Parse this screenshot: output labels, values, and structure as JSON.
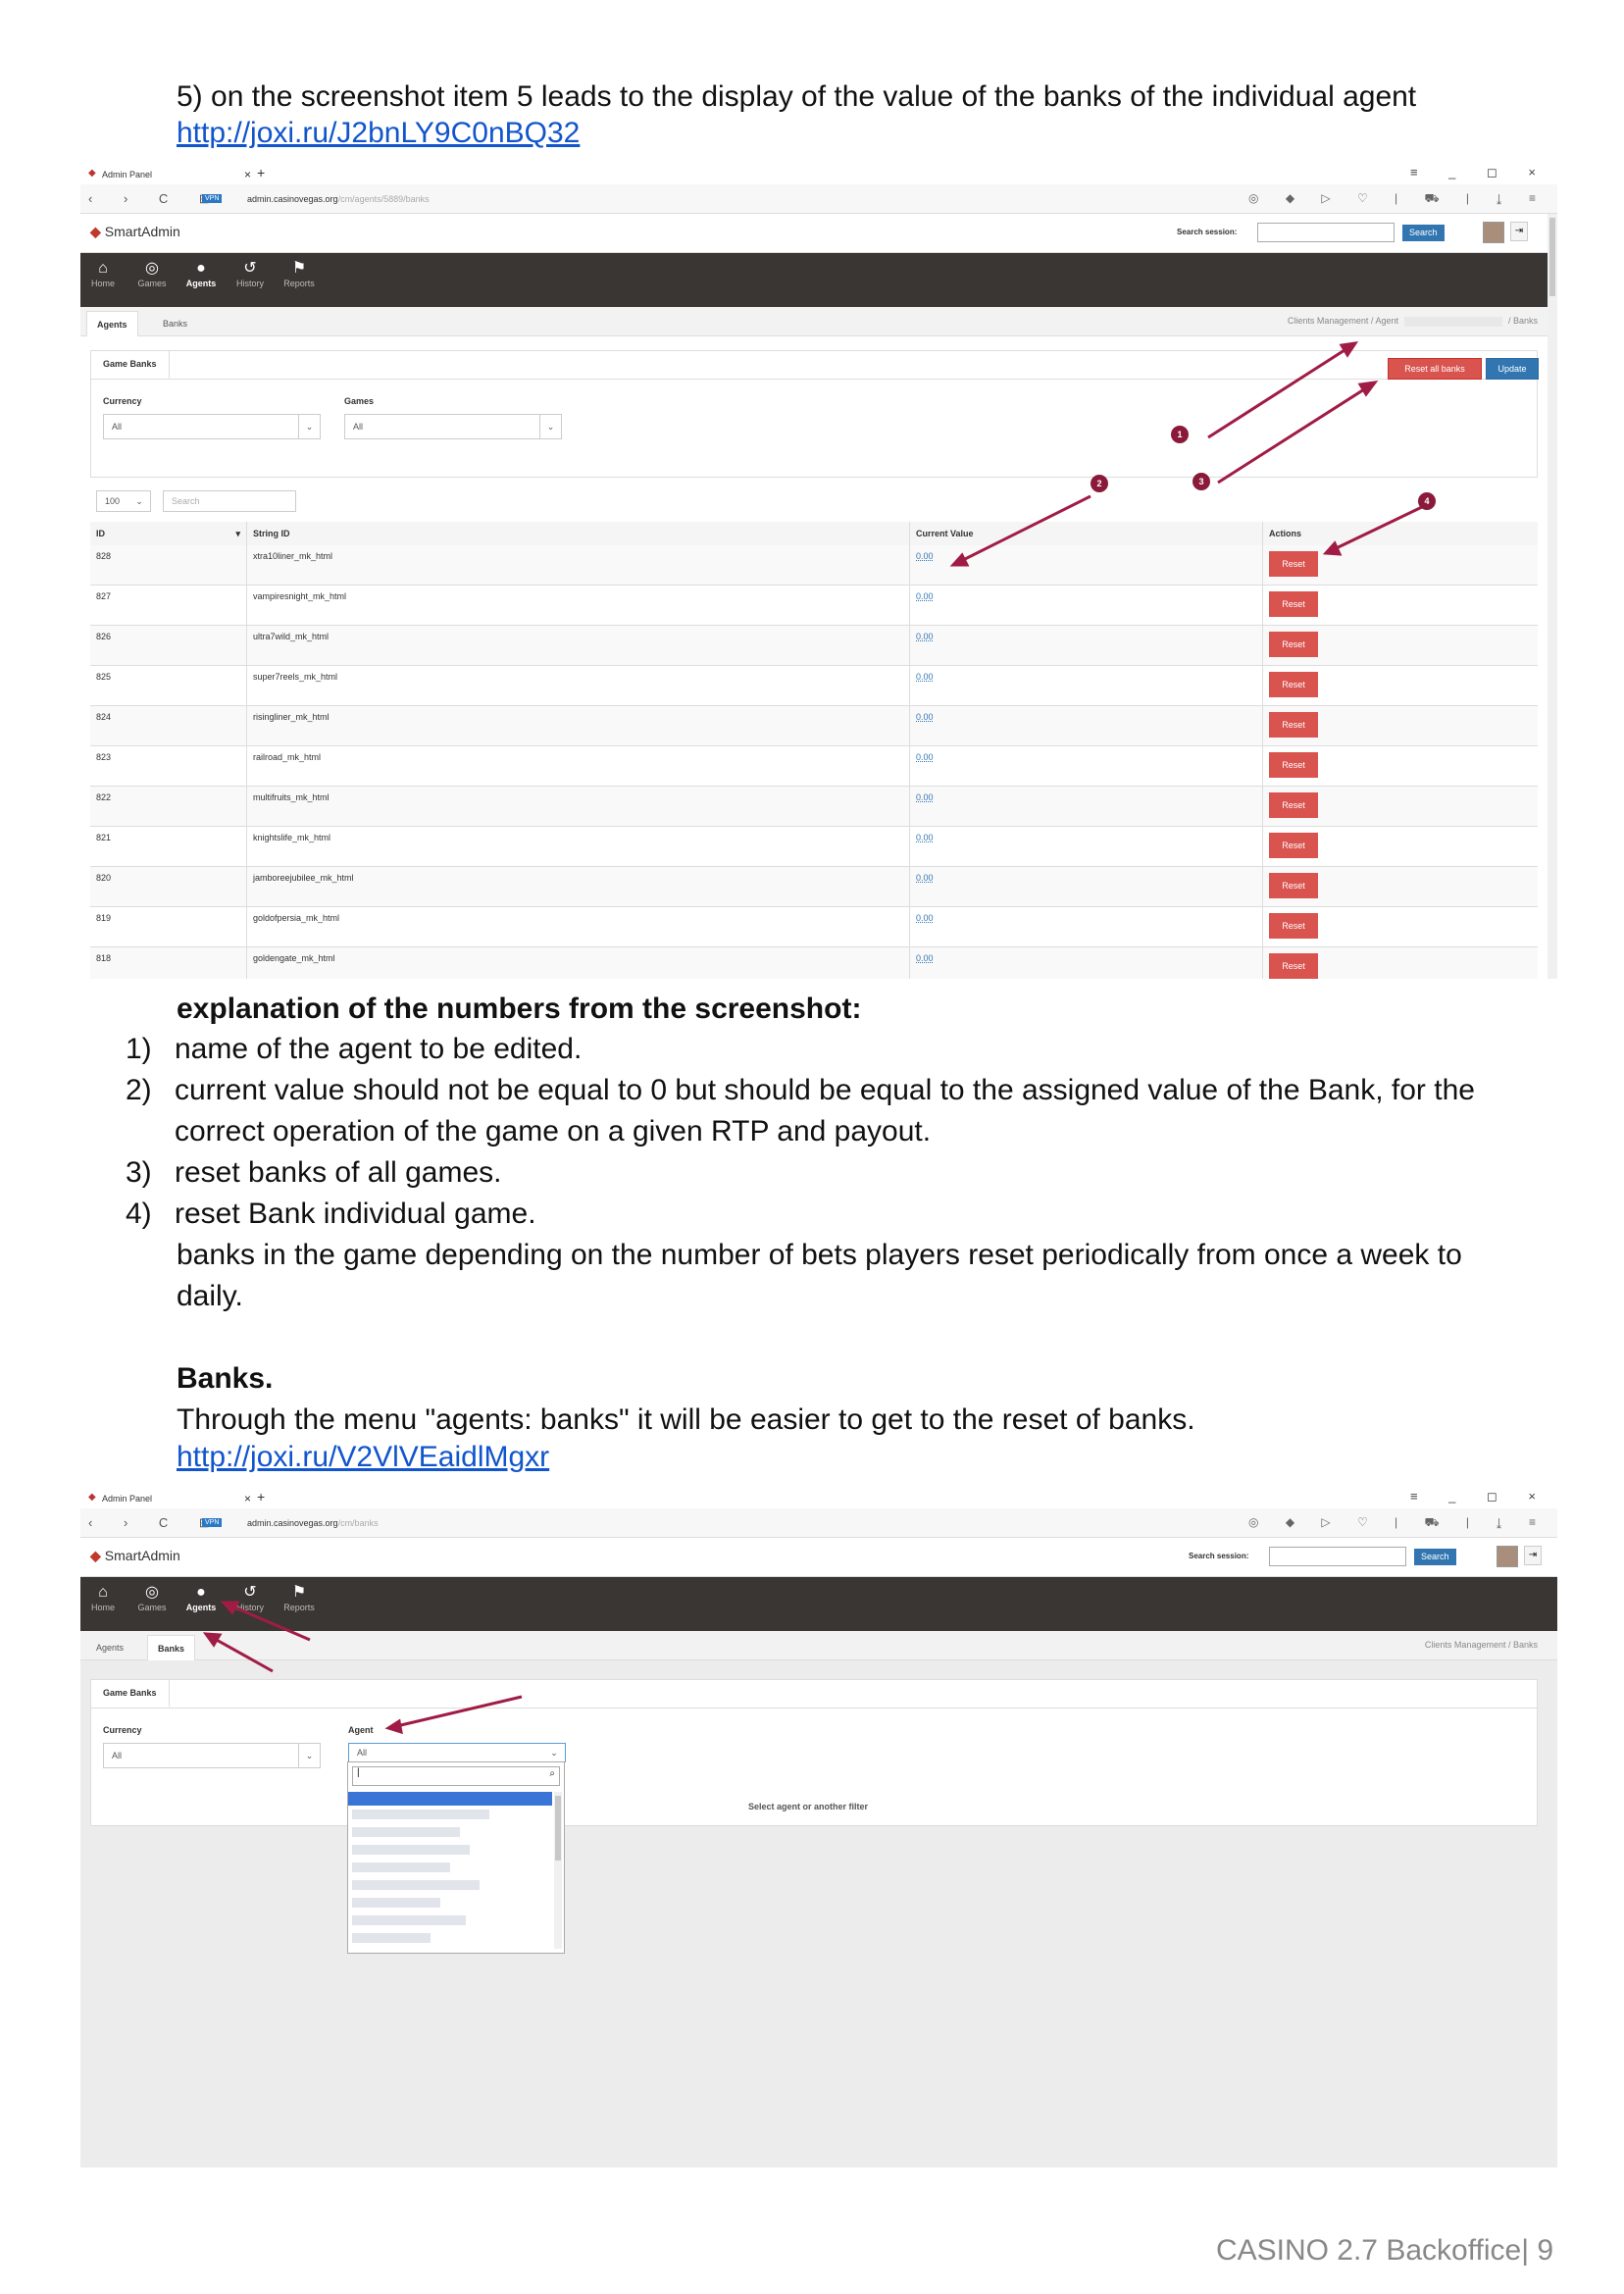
{
  "doc": {
    "intro_line": "5) on the screenshot item 5 leads to the display of the value of the banks of the individual agent",
    "link1": "http://joxi.ru/J2bnLY9C0nBQ32",
    "explanation_heading": "explanation of the numbers from the screenshot:",
    "items": [
      {
        "num": "1)",
        "text": "name of the agent to be edited."
      },
      {
        "num": "2)",
        "text": "current value should not be equal to 0 but should be equal to the assigned value of the Bank, for the correct operation of the game on a given RTP and payout."
      },
      {
        "num": "3)",
        "text": "reset banks of all games."
      },
      {
        "num": "4)",
        "text": "reset Bank individual game."
      }
    ],
    "followup": "banks in the game depending on the number of bets players reset periodically from once a week to daily.",
    "banks_heading": "Banks.",
    "banks_text": "Through the menu \"agents: banks\" it will be easier to get to the reset of banks.",
    "link2": "http://joxi.ru/V2VlVEaidlMgxr",
    "footer": "CASINO 2.7 Backoffice| 9"
  },
  "browser": {
    "tab_title": "Admin Panel",
    "url1_host": "admin.casinovegas.org",
    "url1_path": "/cm/agents/5889/banks",
    "url2_host": "admin.casinovegas.org",
    "url2_path": "/cm/banks",
    "vpn": "VPN"
  },
  "app": {
    "logo": "SmartAdmin",
    "search_label": "Search session:",
    "search_button": "Search",
    "menu": [
      {
        "label": "Home",
        "icon": "home-icon"
      },
      {
        "label": "Games",
        "icon": "gamepad-icon"
      },
      {
        "label": "Agents",
        "icon": "user-icon"
      },
      {
        "label": "History",
        "icon": "history-icon"
      },
      {
        "label": "Reports",
        "icon": "flag-icon"
      }
    ],
    "subtabs": [
      "Agents",
      "Banks"
    ],
    "panel_tab": "Game Banks"
  },
  "shot1": {
    "breadcrumb_a": "Clients Management",
    "breadcrumb_b": "Agent",
    "breadcrumb_c": "Banks",
    "currency_label": "Currency",
    "currency_value": "All",
    "games_label": "Games",
    "games_value": "All",
    "reset_all": "Reset all banks",
    "update": "Update",
    "page_size": "100",
    "search_placeholder": "Search",
    "columns": [
      "ID",
      "String ID",
      "Current Value",
      "Actions"
    ],
    "reset_label": "Reset",
    "rows": [
      {
        "id": "828",
        "sid": "xtra10liner_mk_html",
        "val": "0.00"
      },
      {
        "id": "827",
        "sid": "vampiresnight_mk_html",
        "val": "0.00"
      },
      {
        "id": "826",
        "sid": "ultra7wild_mk_html",
        "val": "0.00"
      },
      {
        "id": "825",
        "sid": "super7reels_mk_html",
        "val": "0.00"
      },
      {
        "id": "824",
        "sid": "risingliner_mk_html",
        "val": "0.00"
      },
      {
        "id": "823",
        "sid": "railroad_mk_html",
        "val": "0.00"
      },
      {
        "id": "822",
        "sid": "multifruits_mk_html",
        "val": "0.00"
      },
      {
        "id": "821",
        "sid": "knightslife_mk_html",
        "val": "0.00"
      },
      {
        "id": "820",
        "sid": "jamboreejubilee_mk_html",
        "val": "0.00"
      },
      {
        "id": "819",
        "sid": "goldofpersia_mk_html",
        "val": "0.00"
      },
      {
        "id": "818",
        "sid": "goldengate_mk_html",
        "val": "0.00"
      }
    ],
    "callouts": [
      "1",
      "2",
      "3",
      "4"
    ]
  },
  "shot2": {
    "breadcrumb_a": "Clients Management",
    "breadcrumb_c": "Banks",
    "currency_label": "Currency",
    "currency_value": "All",
    "agent_label": "Agent",
    "agent_value": "All",
    "hint": "Select agent or another filter"
  },
  "colors": {
    "menubar": "#3a3633",
    "reset_red": "#d9534f",
    "update_blue": "#3276b1",
    "callout": "#8b1a3a",
    "link": "#1155cc"
  }
}
